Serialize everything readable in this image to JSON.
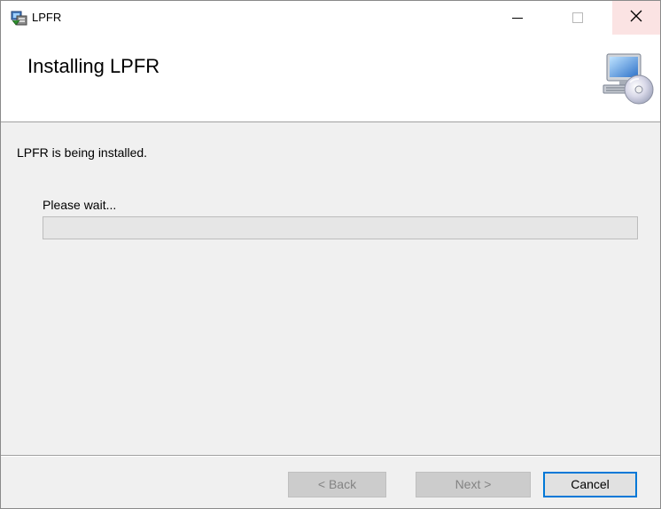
{
  "window": {
    "title": "LPFR",
    "controls": {
      "minimize": "minimize",
      "maximize": "maximize",
      "close": "×"
    }
  },
  "banner": {
    "title": "Installing LPFR",
    "icon": "computer-cd-icon"
  },
  "body": {
    "status": "LPFR is being installed.",
    "wait_label": "Please wait...",
    "progress": 0
  },
  "footer": {
    "back_label": "< Back",
    "next_label": "Next >",
    "cancel_label": "Cancel"
  },
  "colors": {
    "accent": "#0078d7",
    "progress_fill": "#06b025",
    "close_hover": "#fbe3e3"
  }
}
